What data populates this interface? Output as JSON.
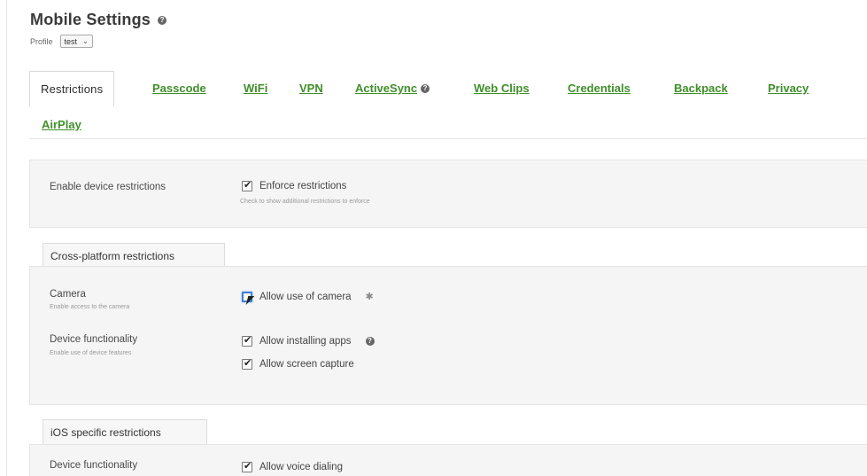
{
  "page": {
    "title": "Mobile Settings",
    "profile_label": "Profile",
    "profile_value": "test"
  },
  "tabs": [
    {
      "label": "Restrictions",
      "active": true
    },
    {
      "label": "Passcode"
    },
    {
      "label": "WiFi"
    },
    {
      "label": "VPN"
    },
    {
      "label": "ActiveSync"
    },
    {
      "label": "Web Clips"
    },
    {
      "label": "Credentials"
    },
    {
      "label": "Backpack"
    },
    {
      "label": "Privacy"
    },
    {
      "label": "AirPlay"
    }
  ],
  "general": {
    "label": "Enable device restrictions",
    "option": "Enforce restrictions",
    "option_checked": true,
    "option_help": "Check to show additional restrictions to enforce"
  },
  "cross_platform": {
    "heading": "Cross-platform restrictions",
    "camera": {
      "label": "Camera",
      "sub": "Enable access to the camera",
      "option": "Allow use of camera",
      "checked": false
    },
    "device": {
      "label": "Device functionality",
      "sub": "Enable use of device features",
      "options": [
        {
          "label": "Allow installing apps",
          "checked": true
        },
        {
          "label": "Allow screen capture",
          "checked": true
        }
      ]
    }
  },
  "ios": {
    "heading": "iOS specific restrictions",
    "device": {
      "label": "Device functionality",
      "options": [
        {
          "label": "Allow voice dialing",
          "checked": true
        }
      ]
    }
  },
  "icons": {
    "help": "help-icon",
    "apple": "apple-icon",
    "android": "android-icon"
  }
}
